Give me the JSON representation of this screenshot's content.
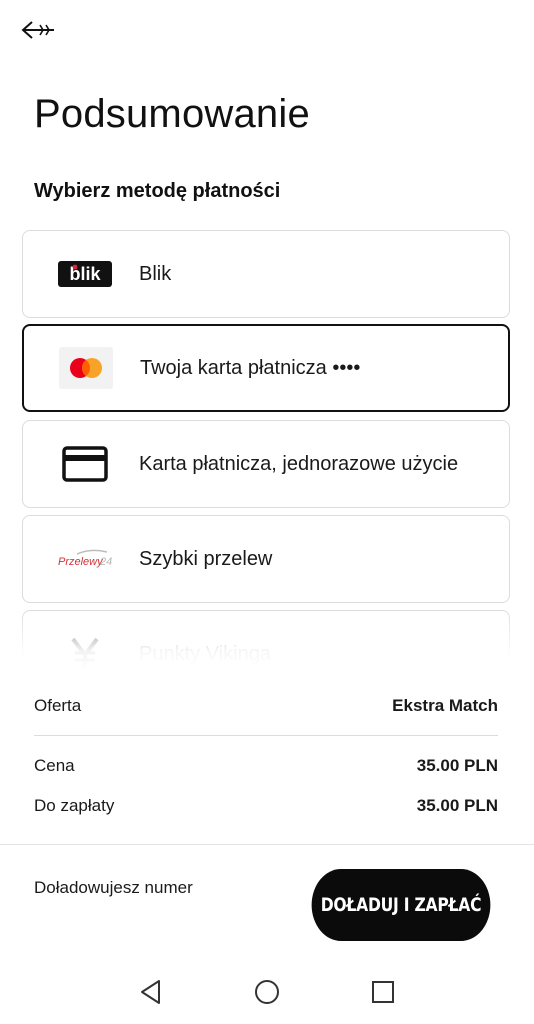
{
  "header": {
    "back_icon": "back-arrow-icon",
    "title": "Podsumowanie"
  },
  "payment": {
    "section_title": "Wybierz metodę płatności",
    "methods": [
      {
        "label": "Blik",
        "icon": "blik-logo",
        "selected": false
      },
      {
        "label": "Twoja karta płatnicza ••••",
        "icon": "mastercard-logo",
        "selected": true
      },
      {
        "label": "Karta płatnicza, jednorazowe użycie",
        "icon": "credit-card-icon",
        "selected": false
      },
      {
        "label": "Szybki przelew",
        "icon": "przelewy24-logo",
        "selected": false
      },
      {
        "label": "Punkty Vikinga",
        "icon": "viking-points-icon",
        "selected": false
      }
    ]
  },
  "summary": {
    "offer_label": "Oferta",
    "offer_value": "Ekstra Match",
    "price_label": "Cena",
    "price_value": "35.00 PLN",
    "total_label": "Do zapłaty",
    "total_value": "35.00 PLN"
  },
  "footer": {
    "note": "Doładowujesz numer",
    "pay_button": "DOŁADUJ I ZAPŁAĆ"
  },
  "colors": {
    "button_bg": "#0b0b0b",
    "mastercard_red": "#eb001b",
    "mastercard_orange": "#f79e1b",
    "przelewy_red": "#d13239"
  },
  "android_nav": [
    "back-triangle-icon",
    "home-circle-icon",
    "recents-square-icon"
  ]
}
